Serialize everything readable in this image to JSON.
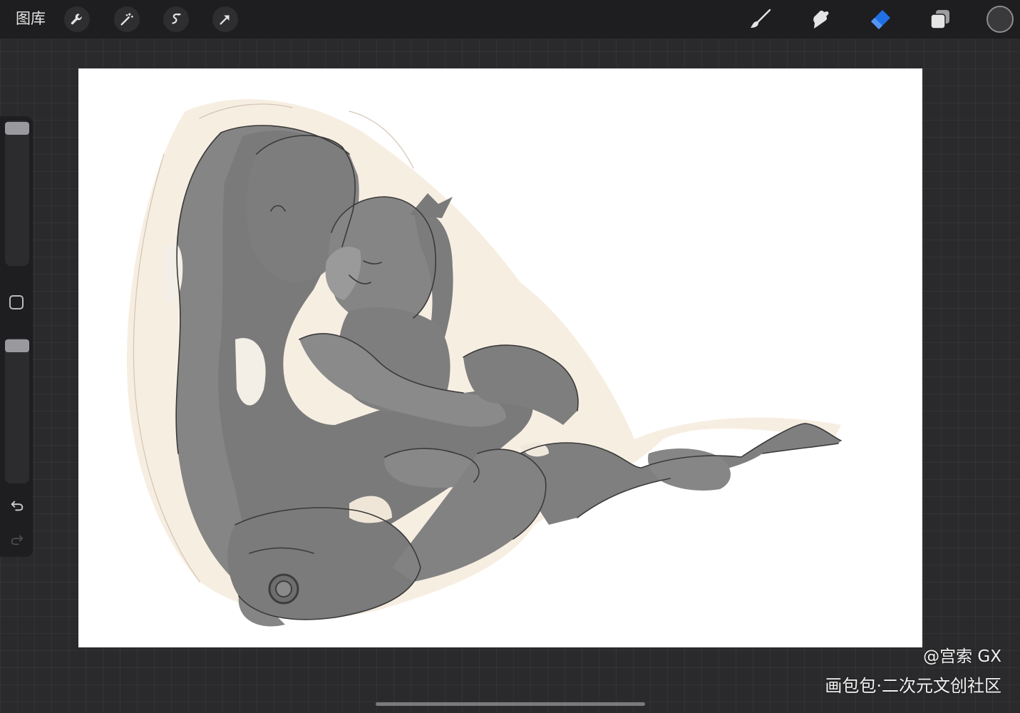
{
  "topbar": {
    "gallery_label": "图库",
    "left_tools": [
      "wrench-icon",
      "magic-wand-icon",
      "selection-icon",
      "transform-arrow-icon"
    ],
    "right_tools": [
      "brush-icon",
      "smudge-icon",
      "eraser-icon",
      "layers-icon"
    ],
    "active_tool": "eraser-icon",
    "active_color": "#1f6fe5",
    "current_color": "#3a3a3c"
  },
  "sidebar": {
    "brush_size_level": 0.97,
    "opacity_level": 0.97,
    "controls": [
      "brush-size-slider",
      "modify-button",
      "opacity-slider",
      "undo-icon",
      "redo-icon"
    ]
  },
  "watermark": {
    "author": "@宫索 GX",
    "site": "画包包·二次元文创社区"
  }
}
